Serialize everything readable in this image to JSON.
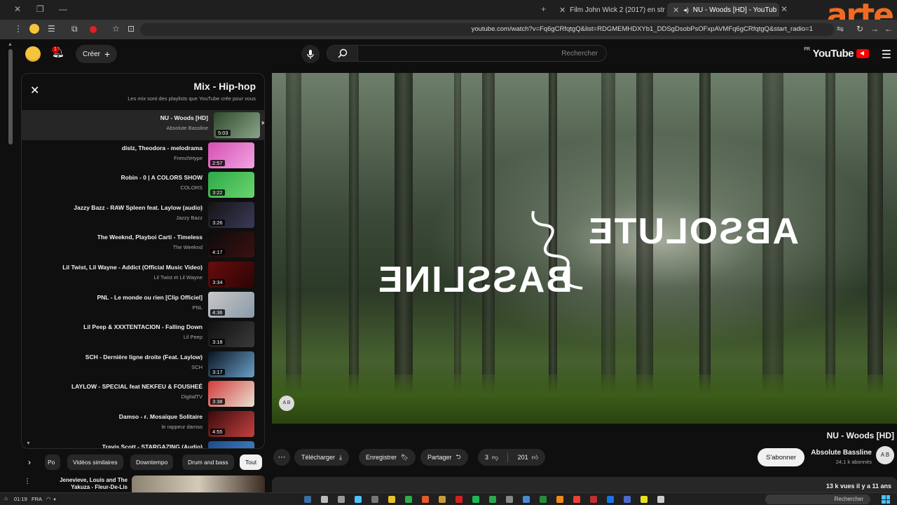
{
  "browser": {
    "tabs": [
      {
        "title": "NU - Woods [HD] - YouTub",
        "active": true
      },
      {
        "title": "Film John Wick 2 (2017) en str",
        "active": false
      }
    ],
    "url": "youtube.com/watch?v=Fq6gCRfqtgQ&list=RDGMEMHDXYb1_DDSgDsobPsOFxpAVMFq6gCRfqtgQ&start_radio=1"
  },
  "header": {
    "logo": "YouTube",
    "logo_region": "FR",
    "search_placeholder": "Rechercher",
    "create_label": "Créer",
    "bell_badge": "1"
  },
  "playlist": {
    "title": "Mix - Hip-hop",
    "subtitle": "Les mix sont des playlists que YouTube crée pour vous",
    "items": [
      {
        "title": "NU - Woods [HD]",
        "channel": "Absolute Bassline",
        "duration": "5:03",
        "current": true,
        "thumb": [
          "#2f4a2b",
          "#8aa58a"
        ]
      },
      {
        "title": "dislz, Theodora - melodrama",
        "channel": "FrenchHype",
        "duration": "2:57",
        "thumb": [
          "#d64fb0",
          "#f1a4e2"
        ]
      },
      {
        "title": "Robin - 0 | A COLORS SHOW",
        "channel": "COLORS",
        "duration": "3:22",
        "thumb": [
          "#2da84a",
          "#6bd66b"
        ]
      },
      {
        "title": "Jazzy Bazz - RAW Spleen feat. Laylow (audio)",
        "channel": "Jazzy Bazz",
        "duration": "3:26",
        "thumb": [
          "#141414",
          "#3a3a5a"
        ]
      },
      {
        "title": "The Weeknd, Playboi Carti - Timeless",
        "channel": "The Weeknd",
        "duration": "4:17",
        "thumb": [
          "#0c0c0c",
          "#3c1010"
        ]
      },
      {
        "title": "Lil Twist, Lil Wayne - Addict (Official Music Video)",
        "channel": "Lil Twist et Lil Wayne",
        "duration": "3:34",
        "thumb": [
          "#6a0c0c",
          "#2a0505"
        ]
      },
      {
        "title": "PNL - Le monde ou rien [Clip Officiel]",
        "channel": "PNL",
        "duration": "4:36",
        "thumb": [
          "#c8c8c8",
          "#8a9aa8"
        ]
      },
      {
        "title": "Lil Peep & XXXTENTACION - Falling Down",
        "channel": "Lil Peep",
        "duration": "3:18",
        "thumb": [
          "#101010",
          "#3a3a3a"
        ]
      },
      {
        "title": "SCH - Dernière ligne droite (Feat. Laylow)",
        "channel": "SCH",
        "duration": "3:17",
        "thumb": [
          "#0a1420",
          "#6aa0c8"
        ]
      },
      {
        "title": "LAYLOW - SPECIAL feat NEKFEU & FOUSHEÉ",
        "channel": "DigitalTV",
        "duration": "3:38",
        "thumb": [
          "#d43a3a",
          "#e8e0d0"
        ]
      },
      {
        "title": "Damso - ғ. Mosaïque Solitaire",
        "channel": "le rappeur damso",
        "duration": "4:55",
        "thumb": [
          "#3a0a0a",
          "#c44040"
        ]
      },
      {
        "title": "Travis Scott - STARGAZING (Audio)",
        "channel": "",
        "duration": "",
        "thumb": [
          "#1c4a8a",
          "#4a8ad0"
        ]
      }
    ]
  },
  "video": {
    "overlay_line1": "ABSOLUTE",
    "overlay_line2": "BASSLINE",
    "overlay_badge": "A B",
    "title": "NU - Woods [HD]",
    "channel": "Absolute Bassline",
    "channel_avatar": "A B",
    "subscribers": "24,1 k abonnés",
    "subscribe_label": "S'abonner",
    "likes": "201",
    "dislikes": "3",
    "share_label": "Partager",
    "save_label": "Enregistrer",
    "download_label": "Télécharger",
    "views": "13 k vues  il y a 11 ans"
  },
  "chips": [
    "Tout",
    "Drum and bass",
    "Downtempo",
    "Vidéos similaires",
    "Po"
  ],
  "related": {
    "title": "Jenevieve, Louis and The Yakuza - Fleur-De-Lis"
  },
  "taskbar": {
    "search_placeholder": "Rechercher",
    "time": "01:19",
    "lang": "FRA"
  }
}
